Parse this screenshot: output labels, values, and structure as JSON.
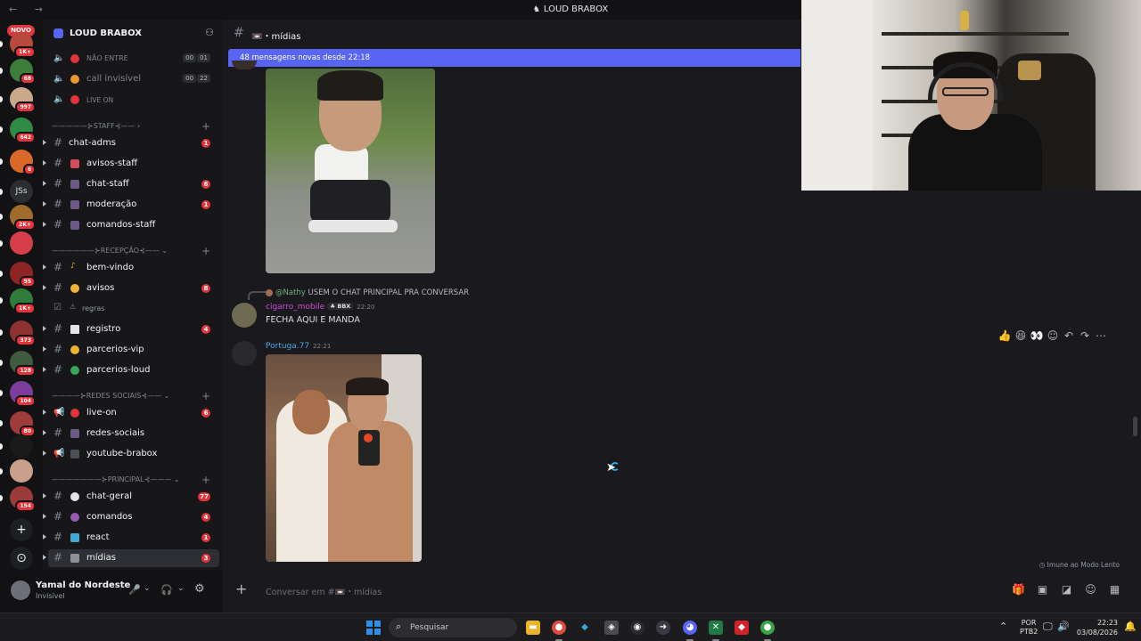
{
  "window": {
    "title": "LOUD BRABOX"
  },
  "rail": {
    "new_label": "NOVO",
    "servers": [
      {
        "badge": "1K+",
        "color": "#b74a3c"
      },
      {
        "badge": "68",
        "color": "#3d7d3b"
      },
      {
        "badge": "997",
        "color": "#c9a98a"
      },
      {
        "badge": "642",
        "color": "#2f8a43"
      },
      {
        "badge": "6",
        "color": "#d9692a"
      },
      {
        "badge": "",
        "color": "#2b2d31",
        "text": "JSs"
      },
      {
        "badge": "2K+",
        "color": "#a06c2b"
      },
      {
        "badge": "",
        "color": "#d63f4a"
      },
      {
        "badge": "95",
        "color": "#8f2424"
      },
      {
        "badge": "1K+",
        "color": "#2f7d3b"
      },
      {
        "badge": "373",
        "color": "#8d3232"
      },
      {
        "badge": "128",
        "color": "#3e5b3f"
      },
      {
        "badge": "104",
        "color": "#7b3c9c"
      },
      {
        "badge": "80",
        "color": "#a03b3b"
      },
      {
        "badge": "",
        "color": "#1a1a1a"
      },
      {
        "badge": "",
        "color": "#c9a18a"
      },
      {
        "badge": "154",
        "color": "#9a3a3a"
      }
    ]
  },
  "server": {
    "name": "LOUD BRABOX",
    "voice": [
      {
        "label": "NÃO ENTRE",
        "counts": [
          "00",
          "01"
        ],
        "dot": "#e3343b"
      },
      {
        "label": "call invisível",
        "counts": [
          "00",
          "22"
        ],
        "dot": "#e89a2d"
      },
      {
        "label": "LIVE ON",
        "counts": [],
        "dot": "#e3343b"
      }
    ],
    "categories": {
      "staff": "STAFF",
      "recepcao": "RECEPÇÃO",
      "redes": "REDES SOCIAIS",
      "principal": "PRINCIPAL"
    },
    "channels": {
      "chat_adms": {
        "label": "chat-adms",
        "badge": "1"
      },
      "avisos_staff": {
        "label": "avisos-staff",
        "badge": ""
      },
      "chat_staff": {
        "label": "chat-staff",
        "badge": "6"
      },
      "moderacao": {
        "label": "moderação",
        "badge": "1"
      },
      "comandos_staff": {
        "label": "comandos-staff",
        "badge": ""
      },
      "bem_vindo": {
        "label": "bem-vindo",
        "badge": ""
      },
      "avisos": {
        "label": "avisos",
        "badge": "8"
      },
      "regras": {
        "label": "regras",
        "badge": ""
      },
      "registro": {
        "label": "registro",
        "badge": "4"
      },
      "parcerios_vip": {
        "label": "parcerios-vip",
        "badge": ""
      },
      "parcerios_loud": {
        "label": "parcerios-loud",
        "badge": ""
      },
      "live_on": {
        "label": "live-on",
        "badge": "6"
      },
      "redes_sociais": {
        "label": "redes-sociais",
        "badge": ""
      },
      "youtube_brabox": {
        "label": "youtube-brabox",
        "badge": ""
      },
      "chat_geral": {
        "label": "chat-geral",
        "badge": "77"
      },
      "comandos": {
        "label": "comandos",
        "badge": "4"
      },
      "react": {
        "label": "react",
        "badge": "1"
      },
      "midias": {
        "label": "mídias",
        "badge": "3"
      }
    }
  },
  "user": {
    "name": "Yamal do Nordeste",
    "status": "Invisível"
  },
  "chat": {
    "channel_name": "mídias",
    "new_messages_banner": "48 mensagens novas desde 22:18",
    "reply": {
      "mention": "@Nathy",
      "text": "USEM O CHAT PRINCIPAL PRA CONVERSAR"
    },
    "messages": [
      {
        "author": "cigarro_mobile",
        "tag": "BBX",
        "time": "22:20",
        "text": "FECHA AQUI E MANDA",
        "color": "#d04ad8"
      },
      {
        "author": "Portuga.77",
        "time": "22:21",
        "color": "#4fa3e0"
      }
    ],
    "slowmode": "Imune ao Modo Lento",
    "composer_placeholder": "Conversar em #📼・mídias"
  },
  "taskbar": {
    "search_placeholder": "Pesquisar",
    "lang_top": "POR",
    "lang_bottom": "PTB2",
    "time": "22:23",
    "date": "03/08/2026"
  }
}
